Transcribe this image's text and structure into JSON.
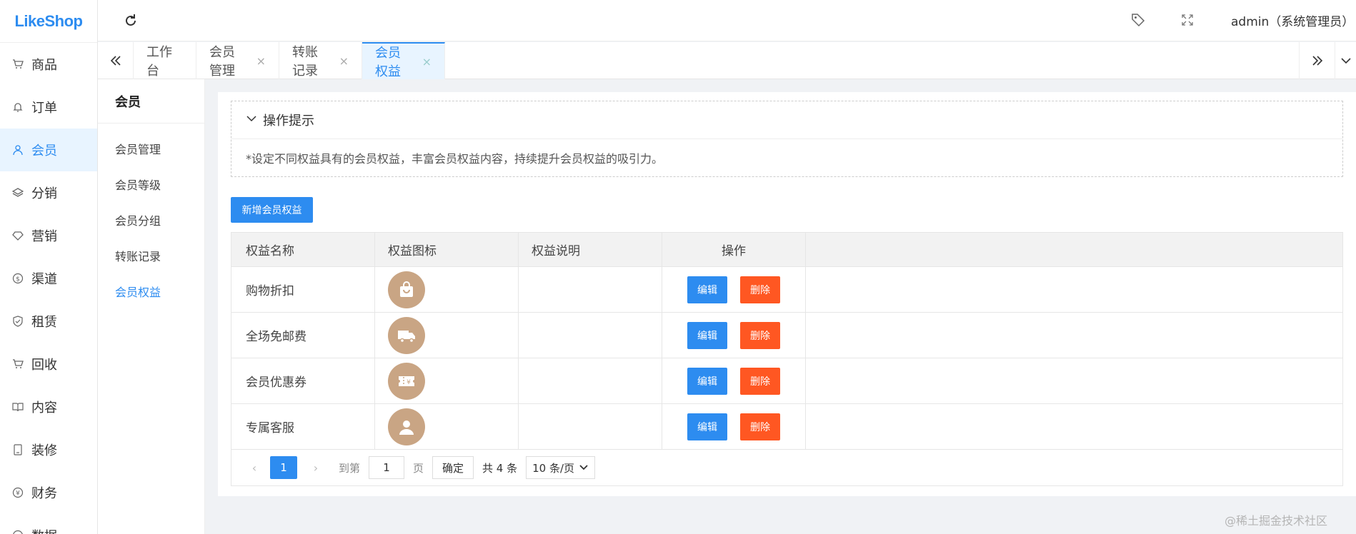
{
  "app": {
    "logo": "LikeShop"
  },
  "sidebar": {
    "items": [
      {
        "label": "商品",
        "icon": "cart-icon"
      },
      {
        "label": "订单",
        "icon": "bell-icon"
      },
      {
        "label": "会员",
        "icon": "user-icon",
        "active": true
      },
      {
        "label": "分销",
        "icon": "layers-icon"
      },
      {
        "label": "营销",
        "icon": "diamond-icon"
      },
      {
        "label": "渠道",
        "icon": "dollar-icon"
      },
      {
        "label": "租赁",
        "icon": "shield-icon"
      },
      {
        "label": "回收",
        "icon": "cart-icon"
      },
      {
        "label": "内容",
        "icon": "book-icon"
      },
      {
        "label": "装修",
        "icon": "tablet-icon"
      },
      {
        "label": "财务",
        "icon": "yen-icon"
      },
      {
        "label": "数据",
        "icon": "chart-icon"
      }
    ]
  },
  "header": {
    "user": "admin（系统管理员）"
  },
  "tabs": [
    {
      "label": "工作台"
    },
    {
      "label": "会员管理"
    },
    {
      "label": "转账记录"
    },
    {
      "label": "会员权益",
      "active": true
    }
  ],
  "submenu": {
    "title": "会员",
    "items": [
      {
        "label": "会员管理"
      },
      {
        "label": "会员等级"
      },
      {
        "label": "会员分组"
      },
      {
        "label": "转账记录"
      },
      {
        "label": "会员权益",
        "active": true
      }
    ]
  },
  "tip": {
    "title": "操作提示",
    "text": "*设定不同权益具有的会员权益，丰富会员权益内容，持续提升会员权益的吸引力。"
  },
  "toolbar": {
    "add_label": "新增会员权益"
  },
  "table": {
    "headers": [
      "权益名称",
      "权益图标",
      "权益说明",
      "操作"
    ],
    "rows": [
      {
        "name": "购物折扣",
        "icon": "shopping-bag-icon",
        "desc": ""
      },
      {
        "name": "全场免邮费",
        "icon": "truck-icon",
        "desc": ""
      },
      {
        "name": "会员优惠券",
        "icon": "coupon-icon",
        "desc": ""
      },
      {
        "name": "专属客服",
        "icon": "person-icon",
        "desc": ""
      }
    ],
    "edit_label": "编辑",
    "delete_label": "删除"
  },
  "pager": {
    "current": "1",
    "goto_label": "到第",
    "page_input": "1",
    "page_suffix": "页",
    "confirm": "确定",
    "total": "共 4 条",
    "per_page": "10 条/页"
  },
  "watermark": "@稀土掘金技术社区"
}
